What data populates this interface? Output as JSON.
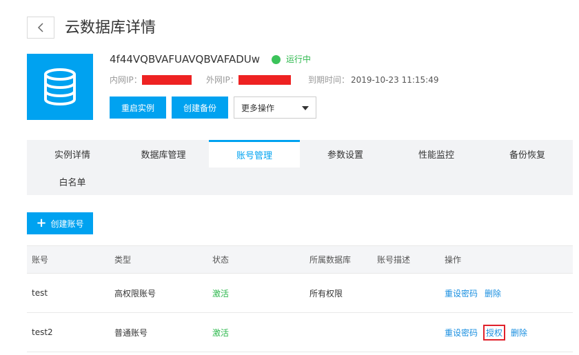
{
  "header": {
    "title": "云数据库详情"
  },
  "instance": {
    "name": "4f44VQBVAFUAVQBVAFADUw",
    "status": "运行中",
    "colors": {
      "brand": "#00a2f0",
      "status": "#2db84d",
      "redaction": "#ee2222"
    },
    "internal_ip_label": "内网IP：",
    "external_ip_label": "外网IP：",
    "expire_label": "到期时间：",
    "expire_value": "2019-10-23 11:15:49"
  },
  "actions": {
    "restart": "重启实例",
    "backup": "创建备份",
    "more": "更多操作"
  },
  "tabs": [
    {
      "label": "实例详情"
    },
    {
      "label": "数据库管理"
    },
    {
      "label": "账号管理",
      "active": true
    },
    {
      "label": "参数设置"
    },
    {
      "label": "性能监控"
    },
    {
      "label": "备份恢复"
    },
    {
      "label": "白名单"
    }
  ],
  "create_account": {
    "icon": "plus-icon",
    "label": "创建账号"
  },
  "table": {
    "headers": [
      "账号",
      "类型",
      "状态",
      "所属数据库",
      "账号描述",
      "操作"
    ],
    "rows": [
      {
        "account": "test",
        "type": "高权限账号",
        "status": "激活",
        "database": "所有权限",
        "description": "",
        "ops": [
          "重设密码",
          "删除"
        ]
      },
      {
        "account": "test2",
        "type": "普通账号",
        "status": "激活",
        "database": "",
        "description": "",
        "ops": [
          "重设密码",
          "授权",
          "删除"
        ]
      }
    ]
  }
}
